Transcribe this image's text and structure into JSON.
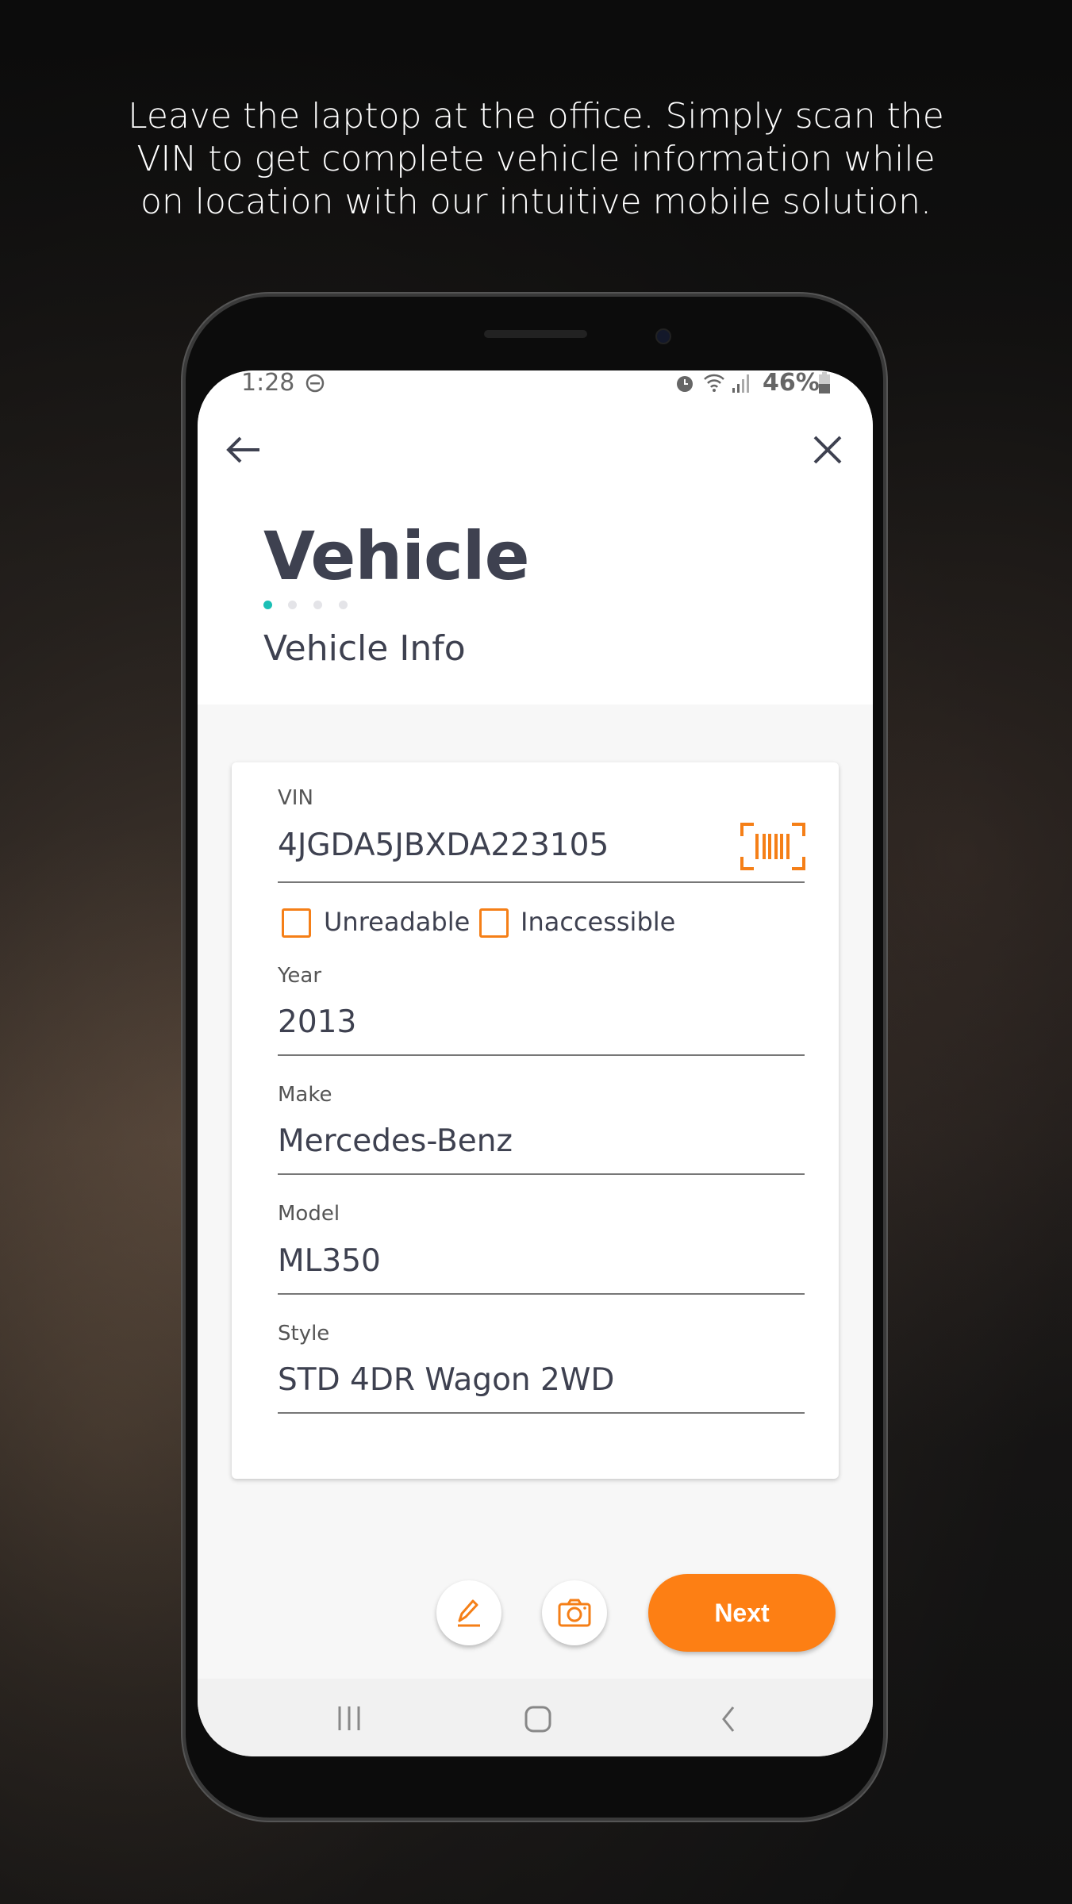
{
  "headline": [
    "Leave the laptop at the office. Simply scan the",
    "VIN to get complete vehicle information while",
    "on location with our intuitive mobile solution."
  ],
  "status": {
    "time": "1:28",
    "battery": "46%"
  },
  "header": {
    "title": "Vehicle",
    "subtitle": "Vehicle Info",
    "steps_total": 4,
    "step_current": 1
  },
  "form": {
    "vin": {
      "label": "VIN",
      "value": "4JGDA5JBXDA223105"
    },
    "checkboxes": [
      {
        "label": "Unreadable",
        "checked": false
      },
      {
        "label": "Inaccessible",
        "checked": false
      }
    ],
    "year": {
      "label": "Year",
      "value": "2013"
    },
    "make": {
      "label": "Make",
      "value": "Mercedes-Benz"
    },
    "model": {
      "label": "Model",
      "value": "ML350"
    },
    "style": {
      "label": "Style",
      "value": "STD 4DR Wagon 2WD"
    }
  },
  "actions": {
    "next_label": "Next"
  },
  "colors": {
    "accent": "#fd7f14",
    "step_active": "#1bbfb5",
    "text": "#3e4150"
  }
}
